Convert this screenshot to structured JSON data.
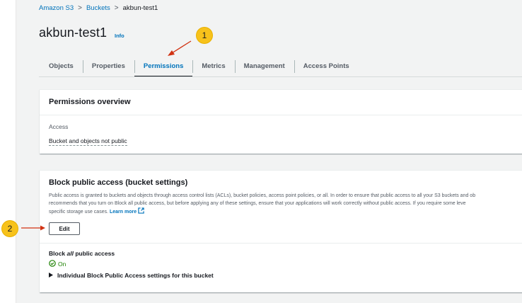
{
  "breadcrumb": {
    "items": [
      "Amazon S3",
      "Buckets",
      "akbun-test1"
    ],
    "separator": ">"
  },
  "header": {
    "title": "akbun-test1",
    "info_link": "Info"
  },
  "tabs": [
    {
      "label": "Objects",
      "active": false
    },
    {
      "label": "Properties",
      "active": false
    },
    {
      "label": "Permissions",
      "active": true
    },
    {
      "label": "Metrics",
      "active": false
    },
    {
      "label": "Management",
      "active": false
    },
    {
      "label": "Access Points",
      "active": false
    }
  ],
  "permissions_overview": {
    "heading": "Permissions overview",
    "access_label": "Access",
    "access_value": "Bucket and objects not public"
  },
  "block_public_access": {
    "heading": "Block public access (bucket settings)",
    "description_line1": "Public access is granted to buckets and objects through access control lists (ACLs), bucket policies, access point policies, or all. In order to ensure that public access to all your S3 buckets and ob",
    "description_line2": "recommends that you turn on Block all public access, but before applying any of these settings, ensure that your applications will work correctly without public access. If you require some leve",
    "description_line3": "specific storage use cases.",
    "learn_more": "Learn more",
    "edit_button": "Edit",
    "block_all_prefix": "Block ",
    "block_all_em": "all",
    "block_all_suffix": " public access",
    "status": "On",
    "expander_label": "Individual Block Public Access settings for this bucket"
  },
  "annotations": {
    "callout1": "1",
    "callout2": "2"
  },
  "colors": {
    "link": "#0073bb",
    "success": "#1d8102",
    "callout": "#f7c21b",
    "arrow": "#d13212"
  },
  "icons": [
    "chevron-right-icon",
    "external-link-icon",
    "check-circle-icon",
    "caret-right-icon",
    "arrow-icon"
  ]
}
